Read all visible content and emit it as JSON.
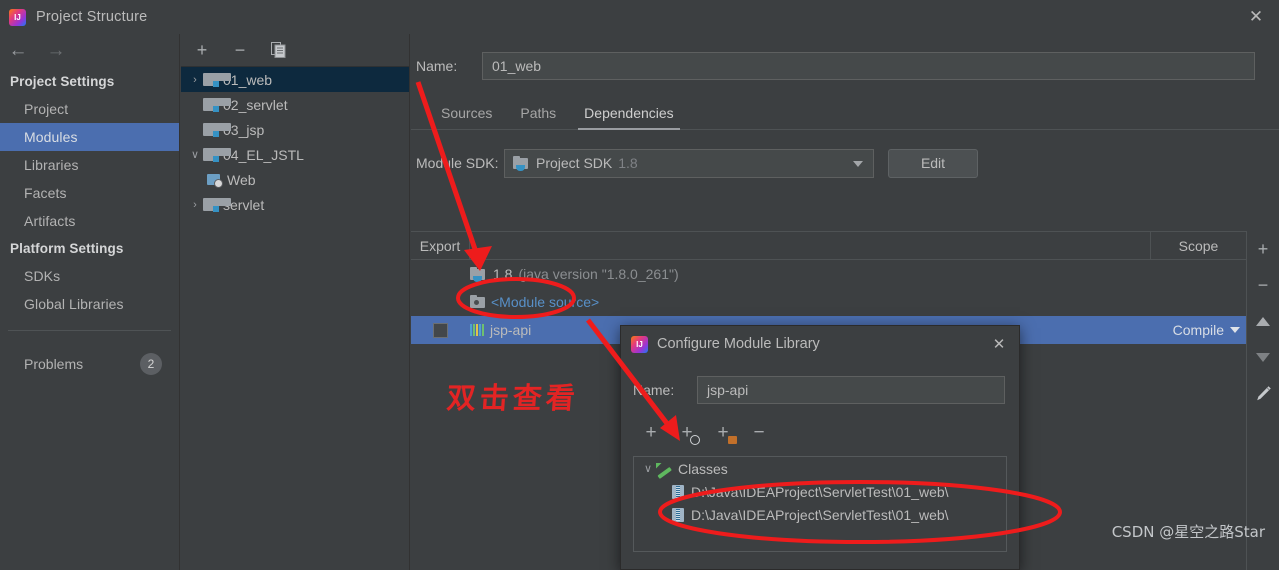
{
  "window": {
    "title": "Project Structure",
    "logo_icon": "intellij-idea-icon",
    "close_icon": "close-icon"
  },
  "nav": {
    "back_icon": "arrow-left-icon",
    "forward_icon": "arrow-right-icon"
  },
  "sidebar": {
    "groups": [
      {
        "label": "Project Settings",
        "items": [
          {
            "label": "Project",
            "selected": false
          },
          {
            "label": "Modules",
            "selected": true
          },
          {
            "label": "Libraries",
            "selected": false
          },
          {
            "label": "Facets",
            "selected": false
          },
          {
            "label": "Artifacts",
            "selected": false
          }
        ]
      },
      {
        "label": "Platform Settings",
        "items": [
          {
            "label": "SDKs",
            "selected": false
          },
          {
            "label": "Global Libraries",
            "selected": false
          }
        ]
      }
    ],
    "problems": {
      "label": "Problems",
      "count": "2"
    }
  },
  "module_tree": {
    "toolbar": [
      {
        "name": "add-module-button",
        "glyph": "+"
      },
      {
        "name": "remove-module-button",
        "glyph": "−"
      },
      {
        "name": "copy-module-button",
        "glyph": "copy-icon"
      }
    ],
    "rows": [
      {
        "label": "01_web",
        "twisty": "›",
        "icon": "module-folder-icon",
        "indent": 0,
        "selected": true
      },
      {
        "label": "02_servlet",
        "twisty": "",
        "icon": "module-folder-icon",
        "indent": 1,
        "selected": false
      },
      {
        "label": "03_jsp",
        "twisty": "",
        "icon": "module-folder-icon",
        "indent": 1,
        "selected": false
      },
      {
        "label": "04_EL_JSTL",
        "twisty": "∨",
        "icon": "module-folder-icon",
        "indent": 0,
        "selected": false
      },
      {
        "label": "Web",
        "twisty": "",
        "icon": "web-facet-icon",
        "indent": 2,
        "selected": false
      },
      {
        "label": "servlet",
        "twisty": "›",
        "icon": "module-folder-icon",
        "indent": 0,
        "selected": false
      }
    ]
  },
  "main": {
    "name_label": "Name:",
    "name_value": "01_web",
    "tabs": [
      {
        "label": "Sources",
        "active": false
      },
      {
        "label": "Paths",
        "active": false
      },
      {
        "label": "Dependencies",
        "active": true
      }
    ],
    "sdk_label": "Module SDK:",
    "sdk_value": "Project SDK",
    "sdk_version": "1.8",
    "sdk_icon": "java-sdk-folder-icon",
    "edit_button": "Edit",
    "table": {
      "columns": [
        "Export",
        "",
        "Scope"
      ],
      "rows": [
        {
          "checkbox": false,
          "show_checkbox": false,
          "icon": "java-sdk-folder-icon",
          "label": "1.8",
          "sublabel": "(java version \"1.8.0_261\")",
          "scope": "",
          "selected": false,
          "link": false
        },
        {
          "checkbox": false,
          "show_checkbox": false,
          "icon": "module-source-icon",
          "label": "<Module source>",
          "sublabel": "",
          "scope": "",
          "selected": false,
          "link": true
        },
        {
          "checkbox": false,
          "show_checkbox": true,
          "icon": "library-jar-icon",
          "label": "jsp-api",
          "sublabel": "",
          "scope": "Compile",
          "selected": true,
          "link": false
        }
      ]
    },
    "table_toolbar": [
      {
        "name": "add-dependency-button",
        "glyph": "+"
      },
      {
        "name": "remove-dependency-button",
        "glyph": "−"
      },
      {
        "name": "move-up-button",
        "glyph": "triangle-up-icon"
      },
      {
        "name": "move-down-button",
        "glyph": "triangle-down-icon"
      },
      {
        "name": "edit-dependency-button",
        "glyph": "pencil-icon"
      }
    ]
  },
  "dialog": {
    "title": "Configure Module Library",
    "logo_icon": "intellij-idea-icon",
    "close_icon": "close-icon",
    "name_label": "Name:",
    "name_value": "jsp-api",
    "toolbar": [
      {
        "name": "add-file-button",
        "glyph": "+"
      },
      {
        "name": "add-classes-button",
        "glyph": "+"
      },
      {
        "name": "add-directory-button",
        "glyph": "+"
      },
      {
        "name": "remove-entry-button",
        "glyph": "−"
      }
    ],
    "tree": [
      {
        "label": "Classes",
        "twisty": "∨",
        "icon": "classes-root-icon",
        "level": 1
      },
      {
        "label": "D:\\Java\\IDEAProject\\ServletTest\\01_web\\",
        "twisty": "",
        "icon": "jar-archive-icon",
        "level": 2
      },
      {
        "label": "D:\\Java\\IDEAProject\\ServletTest\\01_web\\",
        "twisty": "",
        "icon": "jar-archive-icon",
        "level": 2
      }
    ]
  },
  "annotations": {
    "chinese_note": "双击查看",
    "watermark": "CSDN @星空之路Star",
    "highlight_color": "#e32424"
  },
  "colors": {
    "background": "#3c3f41",
    "selection_blue": "#4b6eaf",
    "selection_dark": "#0d293e",
    "text": "#bbbbbb",
    "link": "#5890c8",
    "annotation_red": "#e32424"
  }
}
